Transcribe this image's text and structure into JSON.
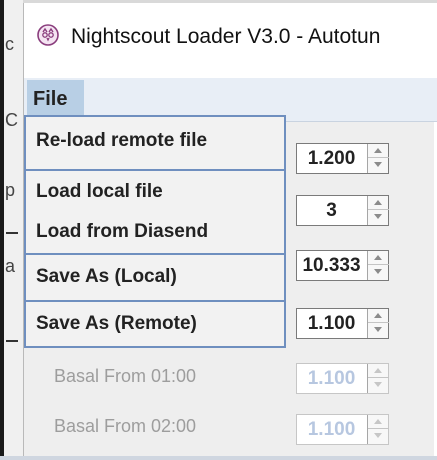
{
  "window": {
    "title": "Nightscout Loader V3.0 - Autotun"
  },
  "background": {
    "left_letters": [
      "c",
      "C",
      "p",
      "a"
    ]
  },
  "menubar": {
    "file_label": "File"
  },
  "file_menu": {
    "items": [
      "Re-load remote file",
      "Load local file",
      "Load from Diasend",
      "Save As (Local)",
      "Save As (Remote)"
    ]
  },
  "spinners": [
    {
      "value": "1.200",
      "enabled": true
    },
    {
      "value": "3",
      "enabled": true
    },
    {
      "value": "10.333",
      "enabled": true
    },
    {
      "value": "1.100",
      "enabled": true
    },
    {
      "value": "1.100",
      "enabled": false
    },
    {
      "value": "1.100",
      "enabled": false
    }
  ],
  "rows": [
    {
      "label": "Basal From 01:00"
    },
    {
      "label": "Basal From 02:00"
    }
  ],
  "icons": {
    "app": "owl-icon",
    "spin_up": "triangle-up-icon",
    "spin_down": "triangle-down-icon"
  },
  "colors": {
    "menu_highlight": "#b8cfe5",
    "menu_border": "#6f8fbf",
    "disabled_value": "#b7c7e0"
  }
}
